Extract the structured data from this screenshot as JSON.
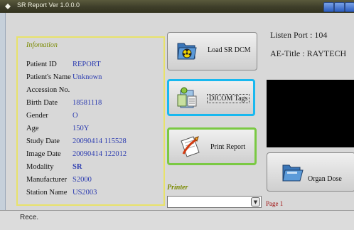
{
  "window": {
    "title": "SR Report  Ver 1.0.0.0"
  },
  "info_panel": {
    "heading": "Infomation",
    "rows": [
      {
        "label": "Patient ID",
        "value": "REPORT"
      },
      {
        "label": "Patient's Name",
        "value": "Unknown"
      },
      {
        "label": "Accession No.",
        "value": ""
      },
      {
        "label": "Birth Date",
        "value": "18581118"
      },
      {
        "label": "Gender",
        "value": "O"
      },
      {
        "label": "Age",
        "value": "150Y"
      },
      {
        "label": "Study Date",
        "value": "20090414   115528"
      },
      {
        "label": "Image Date",
        "value": "20090414   122012"
      },
      {
        "label": "Modality",
        "value": "SR"
      },
      {
        "label": "Manufacturer",
        "value": "S2000"
      },
      {
        "label": "Station Name",
        "value": "US2003"
      }
    ]
  },
  "buttons": {
    "load_sr": "Load SR DCM",
    "dicom_tags": "DICOM Tags",
    "print_report": "Print Report",
    "organ_dose": "Organ Dose"
  },
  "connection": {
    "listen_port": "Listen Port : 104",
    "ae_title": "AE-Title : RAYTECH"
  },
  "printer": {
    "label": "Printer",
    "selected": ""
  },
  "page_label": "Page 1",
  "status": "Rece.",
  "colors": {
    "title_bar": "#3e3e2a",
    "info_border": "#e8e26a",
    "value_text": "#2c3cb0",
    "dicom_border": "#18b8ef",
    "print_border": "#7ac943"
  }
}
